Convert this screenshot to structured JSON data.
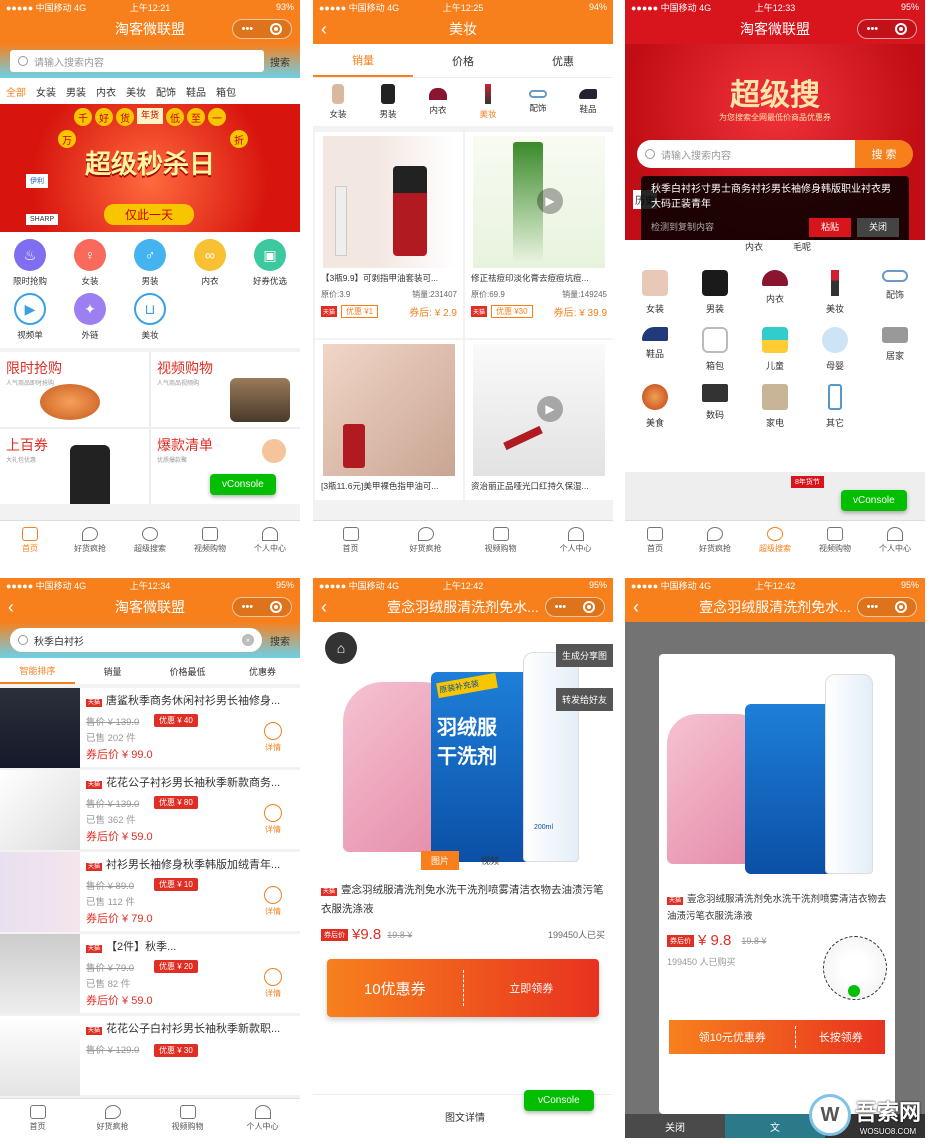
{
  "status": {
    "carrier": "●●●●● 中国移动 4G",
    "battery1": "93%",
    "battery2": "94%",
    "battery3": "95%",
    "times": [
      "上午12:21",
      "上午12:25",
      "上午12:33",
      "上午12:34",
      "上午12:42",
      "上午12:42"
    ]
  },
  "s1": {
    "title": "淘客微联盟",
    "search_placeholder": "请输入搜索内容",
    "search_btn": "搜索",
    "cats": [
      "全部",
      "女装",
      "男装",
      "内衣",
      "美妆",
      "配饰",
      "鞋品",
      "箱包"
    ],
    "banner": {
      "chars": [
        "千",
        "好",
        "货",
        "年货",
        "低",
        "至",
        "一",
        "折",
        "万"
      ],
      "headline": "超级秒杀日",
      "sub": "仅此一天",
      "brands": [
        "伊利",
        "SHARP"
      ]
    },
    "icons": [
      {
        "label": "限时抢购",
        "color": "#7f6ff0"
      },
      {
        "label": "女装",
        "color": "#f96a5c"
      },
      {
        "label": "男装",
        "color": "#44b4f0"
      },
      {
        "label": "内衣",
        "color": "#f8c133"
      },
      {
        "label": "好券优选",
        "color": "#3cc9a0"
      },
      {
        "label": "视频单",
        "color": "#3aa0e8"
      },
      {
        "label": "外链",
        "color": "#9c7ff0"
      },
      {
        "label": "美妆",
        "color": "#3aa0e8"
      }
    ],
    "promos": [
      {
        "h": "限时抢购",
        "s": "人气商品即时抢购"
      },
      {
        "h": "视频购物",
        "s": "人气商品视频购"
      },
      {
        "h": "上百券",
        "s": "大礼包优惠"
      },
      {
        "h": "爆款清单",
        "s": "优质爆款聚"
      }
    ]
  },
  "tabs": [
    "首页",
    "好货疯抢",
    "超级搜索",
    "视频购物",
    "个人中心"
  ],
  "vconsole": "vConsole",
  "s2": {
    "title": "美妆",
    "sorts": [
      "销量",
      "价格",
      "优惠"
    ],
    "cats": [
      "女装",
      "男装",
      "内衣",
      "美妆",
      "配饰",
      "鞋品"
    ],
    "cards": [
      {
        "title": "【3瓶9.9】可剥指甲油套装可...",
        "orig": "原价:3.9",
        "sales": "销量:231407",
        "coupon": "优惠 ¥1",
        "after": "券后: ¥ 2.9",
        "tag": "天猫"
      },
      {
        "title": "修正祛痘印淡化膏去痘痘坑痘...",
        "orig": "原价:69.9",
        "sales": "销量:149245",
        "coupon": "优惠 ¥30",
        "after": "券后: ¥ 39.9",
        "tag": "天猫"
      },
      {
        "title": "[3瓶11.6元]美甲裸色指甲油可...",
        "tag": ""
      },
      {
        "title": "资治丽正品哑光口红持久保湿...",
        "tag": ""
      }
    ]
  },
  "s3": {
    "title": "淘客微联盟",
    "headline": "超级搜",
    "sub": "为您搜索全网最低价商品优惠券",
    "placeholder": "请输入搜索内容",
    "search_btn": "搜 索",
    "clip_text": "秋季白衬衫寸男士商务衬衫男长袖修身韩版职业衬衣男大码正装青年",
    "clip_hint": "检测到复制内容",
    "paste": "粘贴",
    "close": "关闭",
    "history": "历史",
    "hist_items": [
      "内衣",
      "毛呢"
    ],
    "cats": [
      "女装",
      "男装",
      "内衣",
      "美妆",
      "配饰",
      "鞋品",
      "箱包",
      "儿童",
      "母婴",
      "居家",
      "美食",
      "数码",
      "家电",
      "其它"
    ],
    "banner_text": "8年货节"
  },
  "s4": {
    "title": "淘客微联盟",
    "query": "秋季白衬衫",
    "search_btn": "搜索",
    "sorts": [
      "智能排序",
      "销量",
      "价格最低",
      "优惠券"
    ],
    "items": [
      {
        "name": "唐鲨秋季商务休闲衬衫男长袖修身...",
        "price": "售价 ¥ 139.0",
        "sold": "已售 202 件",
        "after": "券后价 ¥ 99.0",
        "coupon": "优惠 ¥ 40",
        "detail": "详情"
      },
      {
        "name": "花花公子衬衫男长袖秋季新款商务...",
        "price": "售价 ¥ 139.0",
        "sold": "已售 362 件",
        "after": "券后价 ¥ 59.0",
        "coupon": "优惠 ¥ 80",
        "detail": "详情"
      },
      {
        "name": "衬衫男长袖修身秋季韩版加绒青年...",
        "price": "售价 ¥ 89.0",
        "sold": "已售 112 件",
        "after": "券后价 ¥ 79.0",
        "coupon": "优惠 ¥ 10",
        "detail": "详情"
      },
      {
        "name": "【2件】秋季...",
        "price": "售价 ¥ 79.0",
        "sold": "已售 82 件",
        "after": "券后价 ¥ 59.0",
        "coupon": "优惠 ¥ 20",
        "detail": "详情"
      },
      {
        "name": "花花公子白衬衫男长袖秋季新款职...",
        "price": "售价 ¥ 129.0",
        "sold": "",
        "after": "",
        "coupon": "优惠 ¥ 30",
        "detail": ""
      }
    ]
  },
  "s5": {
    "title": "壹念羽绒服清洗剂免水...",
    "share_img": "生成分享图",
    "share_friend": "转发给好友",
    "media": [
      "图片",
      "视频"
    ],
    "name": "壹念羽绒服清洗剂免水洗干洗剂喷雾清洁衣物去油渍污笔衣服洗涤液",
    "tag": "天猫",
    "price_label": "券后价",
    "price": "¥9.8",
    "orig": "19.8 ¥",
    "buyers": "199450人已买",
    "coupon": "10优惠券",
    "get": "立即领券",
    "detail_tab": "图文详情",
    "product_text": [
      "原装补充装",
      "羽绒服",
      "干洗剂",
      "200ml"
    ]
  },
  "s6": {
    "title": "壹念羽绒服清洗剂免水...",
    "name": "壹念羽绒服清洗剂免水洗干洗剂喷雾清洁衣物去油渍污笔衣服洗涤液",
    "tag": "天猫",
    "price_label": "券后价",
    "price": "¥ 9.8",
    "orig": "19.8 ¥",
    "buyers": "199450 人已购买",
    "get": "领10元优惠券",
    "long": "长按领券",
    "close": "关闭",
    "under": "文"
  },
  "watermark": {
    "brand": "吾索网",
    "url": "WOSUO8.COM"
  }
}
